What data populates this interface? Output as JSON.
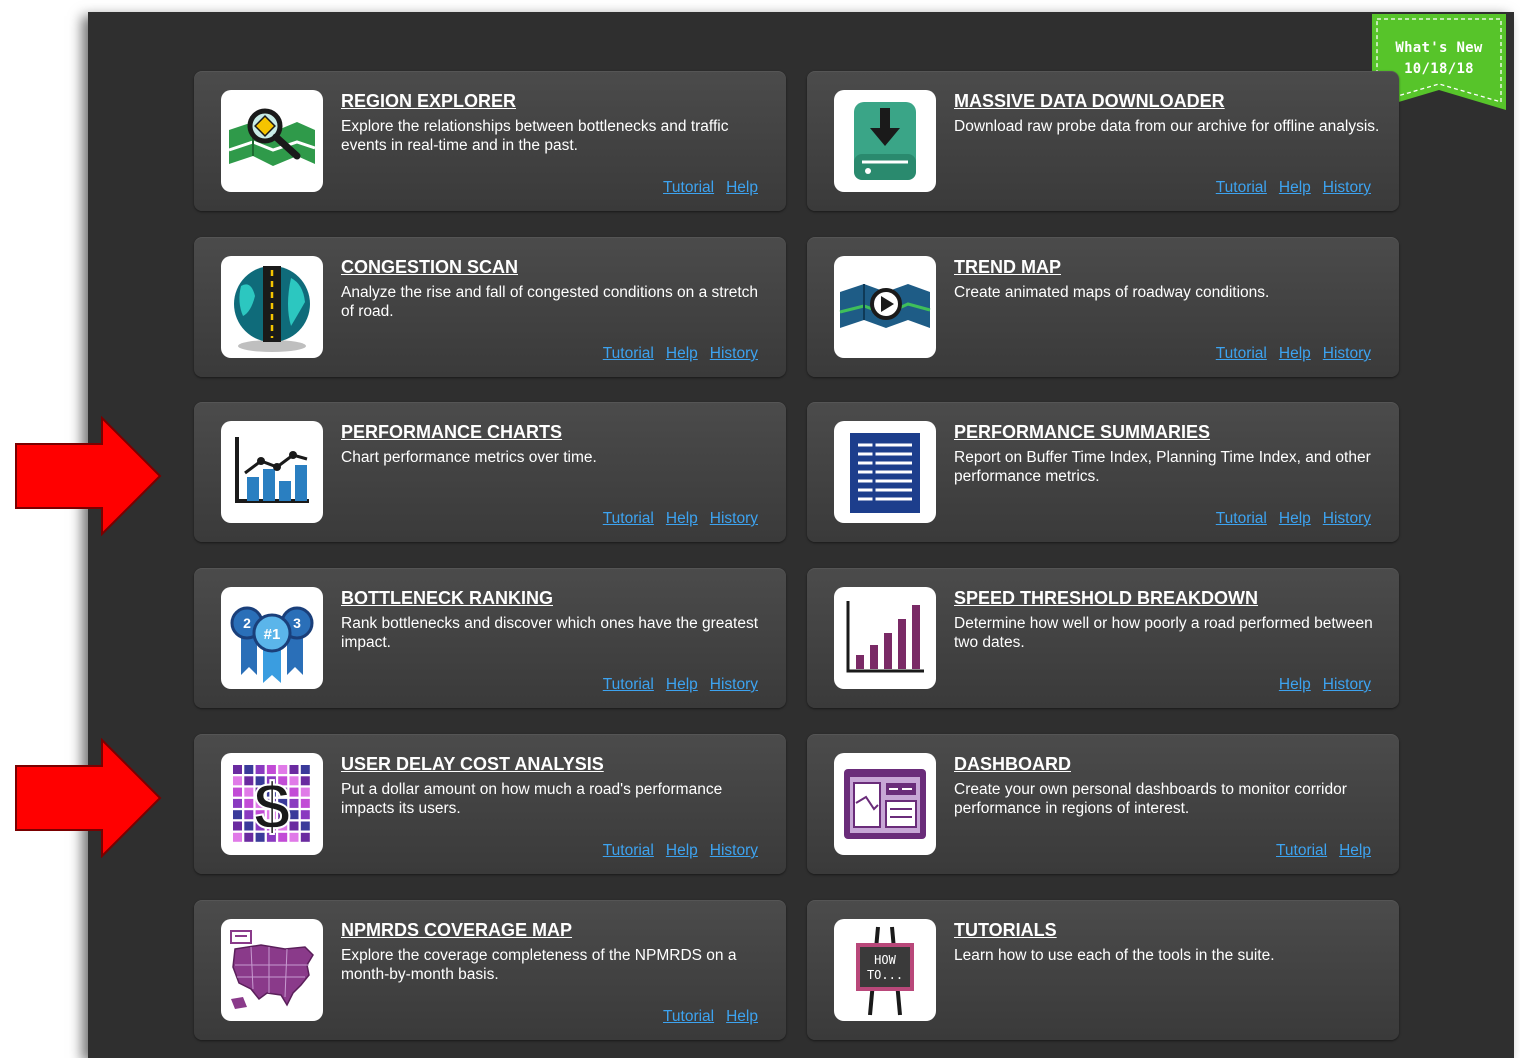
{
  "colors": {
    "link": "#3da3f0",
    "card_bg": "#434343",
    "panel_bg": "#2f2f2f",
    "ribbon": "#57c42a",
    "arrow": "#ff0000"
  },
  "ribbon": {
    "line1": "What's New",
    "line2": "10/18/18"
  },
  "cards": [
    {
      "title": "REGION EXPLORER",
      "icon": "region-explorer-map-icon",
      "desc": "Explore the relationships between bottlenecks and traffic events in real-time and in the past.",
      "links": {
        "tutorial": "Tutorial",
        "help": "Help"
      }
    },
    {
      "title": "MASSIVE DATA DOWNLOADER",
      "icon": "download-drive-icon",
      "desc": "Download raw probe data from our archive for offline analysis.",
      "links": {
        "tutorial": "Tutorial",
        "help": "Help",
        "history": "History"
      }
    },
    {
      "title": "CONGESTION SCAN",
      "icon": "congestion-scan-road-icon",
      "desc": "Analyze the rise and fall of congested conditions on a stretch of road.",
      "links": {
        "tutorial": "Tutorial",
        "help": "Help",
        "history": "History"
      }
    },
    {
      "title": "TREND MAP",
      "icon": "trend-map-play-icon",
      "desc": "Create animated maps of roadway conditions.",
      "links": {
        "tutorial": "Tutorial",
        "help": "Help",
        "history": "History"
      }
    },
    {
      "title": "PERFORMANCE CHARTS",
      "icon": "performance-chart-icon",
      "desc": "Chart performance metrics over time.",
      "links": {
        "tutorial": "Tutorial",
        "help": "Help",
        "history": "History"
      }
    },
    {
      "title": "PERFORMANCE SUMMARIES",
      "icon": "summary-document-icon",
      "desc": "Report on Buffer Time Index, Planning Time Index, and other performance metrics.",
      "links": {
        "tutorial": "Tutorial",
        "help": "Help",
        "history": "History"
      }
    },
    {
      "title": "BOTTLENECK RANKING",
      "icon": "ranking-ribbons-icon",
      "desc": "Rank bottlenecks and discover which ones have the greatest impact.",
      "links": {
        "tutorial": "Tutorial",
        "help": "Help",
        "history": "History"
      }
    },
    {
      "title": "SPEED THRESHOLD BREAKDOWN",
      "icon": "speed-bars-icon",
      "desc": "Determine how well or how poorly a road performed between two dates.",
      "links": {
        "help": "Help",
        "history": "History"
      }
    },
    {
      "title": "USER DELAY COST ANALYSIS",
      "icon": "dollar-grid-icon",
      "desc": "Put a dollar amount on how much a road's performance impacts its users.",
      "links": {
        "tutorial": "Tutorial",
        "help": "Help",
        "history": "History"
      }
    },
    {
      "title": "DASHBOARD",
      "icon": "dashboard-screen-icon",
      "desc": "Create your own personal dashboards to monitor corridor performance in regions of interest.",
      "links": {
        "tutorial": "Tutorial",
        "help": "Help"
      }
    },
    {
      "title": "NPMRDS COVERAGE MAP",
      "icon": "us-coverage-map-icon",
      "desc": "Explore the coverage completeness of the NPMRDS on a month-by-month basis.",
      "links": {
        "tutorial": "Tutorial",
        "help": "Help"
      }
    },
    {
      "title": "TUTORIALS",
      "icon": "how-to-easel-icon",
      "desc": "Learn how to use each of the tools in the suite.",
      "links": {}
    }
  ],
  "icon_text": {
    "how_to_1": "HOW",
    "how_to_2": "TO...",
    "rank1": "#1",
    "rank2": "2",
    "rank3": "3",
    "dollar": "$"
  }
}
